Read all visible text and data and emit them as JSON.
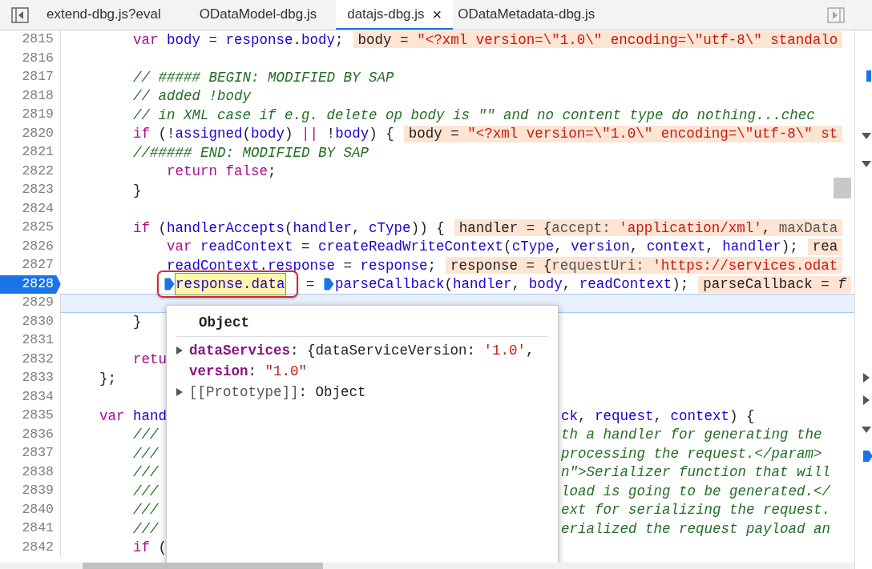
{
  "tabs": [
    {
      "label": "extend-dbg.js?eval",
      "selected": false,
      "closable": false
    },
    {
      "label": "ODataModel-dbg.js",
      "selected": false,
      "closable": false
    },
    {
      "label": "datajs-dbg.js",
      "selected": true,
      "closable": true
    },
    {
      "label": "ODataMetadata-dbg.js",
      "selected": false,
      "closable": false
    }
  ],
  "tab_close": "×",
  "lines": [
    {
      "n": "2815",
      "paused": false,
      "highlighted": false,
      "kind": "two",
      "parts": [
        {
          "kind": "code",
          "tokens": [
            {
              "kind": "keyword",
              "text": "var"
            },
            {
              "kind": "ident",
              "text": " body"
            },
            {
              "kind": "punct",
              "text": " = "
            },
            {
              "kind": "ident",
              "text": "response"
            },
            {
              "kind": "punct",
              "text": "."
            },
            {
              "kind": "ident",
              "text": "body"
            },
            {
              "kind": "punct",
              "text": ";"
            }
          ]
        },
        {
          "kind": "value",
          "tokens": [
            {
              "kind": "punct",
              "text": "body = "
            },
            {
              "kind": "string",
              "text": "\"<?xml version=\\\"1.0\\\" encoding=\\\"utf-8\\\" standalo"
            }
          ]
        }
      ]
    },
    {
      "n": "2816",
      "paused": false,
      "highlighted": false
    },
    {
      "n": "2817",
      "paused": false,
      "highlighted": false,
      "kind": "two",
      "parts": [
        {
          "kind": "code",
          "tokens": [
            {
              "kind": "comment",
              "text": "// ##### BEGIN: MODIFIED BY SAP"
            }
          ]
        }
      ]
    },
    {
      "n": "2818",
      "paused": false,
      "highlighted": false,
      "kind": "two",
      "parts": [
        {
          "kind": "code",
          "tokens": [
            {
              "kind": "comment",
              "text": "// added !body"
            }
          ]
        }
      ]
    },
    {
      "n": "2819",
      "paused": false,
      "highlighted": false,
      "kind": "two",
      "parts": [
        {
          "kind": "code",
          "tokens": [
            {
              "kind": "comment",
              "text": "// in XML case if e.g. delete op body is \"\" and no content type do nothing...chec"
            }
          ]
        }
      ]
    },
    {
      "n": "2820",
      "paused": false,
      "highlighted": false,
      "kind": "two",
      "parts": [
        {
          "kind": "code",
          "tokens": [
            {
              "kind": "keyword",
              "text": "if"
            },
            {
              "kind": "punct",
              "text": " (!"
            },
            {
              "kind": "ident",
              "text": "assigned"
            },
            {
              "kind": "punct",
              "text": "("
            },
            {
              "kind": "ident",
              "text": "body"
            },
            {
              "kind": "punct",
              "text": ") "
            },
            {
              "kind": "keyword",
              "text": "||"
            },
            {
              "kind": "punct",
              "text": " !"
            },
            {
              "kind": "ident",
              "text": "body"
            },
            {
              "kind": "punct",
              "text": ") {"
            }
          ]
        },
        {
          "kind": "value",
          "tokens": [
            {
              "kind": "punct",
              "text": "body = "
            },
            {
              "kind": "string",
              "text": "\"<?xml version=\\\"1.0\\\" encoding=\\\"utf-8\\\" st"
            }
          ]
        }
      ]
    },
    {
      "n": "2821",
      "paused": false,
      "highlighted": false,
      "kind": "two",
      "parts": [
        {
          "kind": "code",
          "tokens": [
            {
              "kind": "comment",
              "text": "//##### END: MODIFIED BY SAP"
            }
          ]
        }
      ]
    },
    {
      "n": "2822",
      "paused": false,
      "highlighted": false,
      "kind": "three",
      "parts": [
        {
          "kind": "code",
          "tokens": [
            {
              "kind": "keyword",
              "text": "return false"
            },
            {
              "kind": "punct",
              "text": ";"
            }
          ]
        }
      ]
    },
    {
      "n": "2823",
      "paused": false,
      "highlighted": false,
      "kind": "two",
      "parts": [
        {
          "kind": "code",
          "tokens": [
            {
              "kind": "punct",
              "text": "}"
            }
          ]
        }
      ]
    },
    {
      "n": "2824",
      "paused": false,
      "highlighted": false
    },
    {
      "n": "2825",
      "paused": false,
      "highlighted": false,
      "kind": "two",
      "parts": [
        {
          "kind": "code",
          "tokens": [
            {
              "kind": "keyword",
              "text": "if"
            },
            {
              "kind": "punct",
              "text": " ("
            },
            {
              "kind": "ident",
              "text": "handlerAccepts"
            },
            {
              "kind": "punct",
              "text": "("
            },
            {
              "kind": "ident",
              "text": "handler"
            },
            {
              "kind": "punct",
              "text": ", "
            },
            {
              "kind": "ident",
              "text": "cType"
            },
            {
              "kind": "punct",
              "text": ")) {"
            }
          ]
        },
        {
          "kind": "value",
          "tokens": [
            {
              "kind": "punct",
              "text": "handler = {"
            },
            {
              "kind": "key",
              "text": "accept: "
            },
            {
              "kind": "string",
              "text": "'application/xml'"
            },
            {
              "kind": "punct",
              "text": ", "
            },
            {
              "kind": "key",
              "text": "maxData"
            }
          ]
        }
      ]
    },
    {
      "n": "2826",
      "paused": false,
      "highlighted": false,
      "kind": "three",
      "parts": [
        {
          "kind": "code",
          "tokens": [
            {
              "kind": "keyword",
              "text": "var"
            },
            {
              "kind": "ident",
              "text": " readContext"
            },
            {
              "kind": "punct",
              "text": " = "
            },
            {
              "kind": "ident",
              "text": "createReadWriteContext"
            },
            {
              "kind": "punct",
              "text": "("
            },
            {
              "kind": "ident",
              "text": "cType"
            },
            {
              "kind": "punct",
              "text": ", "
            },
            {
              "kind": "ident",
              "text": "version"
            },
            {
              "kind": "punct",
              "text": ", "
            },
            {
              "kind": "ident",
              "text": "context"
            },
            {
              "kind": "punct",
              "text": ", "
            },
            {
              "kind": "ident",
              "text": "handler"
            },
            {
              "kind": "punct",
              "text": ");"
            }
          ]
        },
        {
          "kind": "value",
          "tokens": [
            {
              "kind": "punct",
              "text": "rea"
            }
          ]
        }
      ]
    },
    {
      "n": "2827",
      "paused": false,
      "highlighted": false,
      "kind": "three",
      "parts": [
        {
          "kind": "code",
          "tokens": [
            {
              "kind": "ident",
              "text": "readContext"
            },
            {
              "kind": "punct",
              "text": "."
            },
            {
              "kind": "ident",
              "text": "response"
            },
            {
              "kind": "punct",
              "text": " = "
            },
            {
              "kind": "ident",
              "text": "response"
            },
            {
              "kind": "punct",
              "text": ";"
            }
          ]
        },
        {
          "kind": "value",
          "tokens": [
            {
              "kind": "punct",
              "text": "response = {"
            },
            {
              "kind": "key",
              "text": "requestUri: "
            },
            {
              "kind": "string",
              "text": "'https://services.odat"
            }
          ]
        }
      ]
    },
    {
      "n": "2828",
      "paused": true,
      "highlighted": false,
      "kind": "three",
      "parts": [
        {
          "kind": "inspected",
          "tokens": [
            {
              "kind": "ident",
              "text": "response.data"
            }
          ]
        },
        {
          "kind": "code",
          "tokens": [
            {
              "kind": "punct",
              "text": " = "
            }
          ]
        },
        {
          "kind": "breakpoint"
        },
        {
          "kind": "code",
          "tokens": [
            {
              "kind": "ident",
              "text": "parseCallback"
            },
            {
              "kind": "punct",
              "text": "("
            },
            {
              "kind": "ident",
              "text": "handler"
            },
            {
              "kind": "punct",
              "text": ", "
            },
            {
              "kind": "ident",
              "text": "body"
            },
            {
              "kind": "punct",
              "text": ", "
            },
            {
              "kind": "ident",
              "text": "readContext"
            },
            {
              "kind": "punct",
              "text": ");"
            }
          ]
        },
        {
          "kind": "value",
          "tokens": [
            {
              "kind": "punct",
              "text": "parseCallback = "
            },
            {
              "kind": "italic",
              "text": "f"
            }
          ]
        }
      ]
    },
    {
      "n": "2829",
      "paused": false,
      "highlighted": true
    },
    {
      "n": "2830",
      "paused": false,
      "highlighted": false,
      "kind": "two",
      "parts": [
        {
          "kind": "code",
          "tokens": [
            {
              "kind": "punct",
              "text": "}"
            }
          ]
        }
      ]
    },
    {
      "n": "2831",
      "paused": false,
      "highlighted": false
    },
    {
      "n": "2832",
      "paused": false,
      "highlighted": false,
      "kind": "two",
      "parts": [
        {
          "kind": "code",
          "tokens": [
            {
              "kind": "keyword",
              "text": "retu"
            }
          ]
        }
      ]
    },
    {
      "n": "2833",
      "paused": false,
      "highlighted": false,
      "kind": "one",
      "parts": [
        {
          "kind": "code",
          "tokens": [
            {
              "kind": "punct",
              "text": "};"
            }
          ]
        }
      ]
    },
    {
      "n": "2834",
      "paused": false,
      "highlighted": false
    },
    {
      "n": "2835",
      "paused": false,
      "highlighted": false,
      "kind": "one",
      "parts": [
        {
          "kind": "code",
          "tokens": [
            {
              "kind": "keyword",
              "text": "var"
            },
            {
              "kind": "ident",
              "text": " hand"
            }
          ]
        },
        {
          "kind": "right",
          "tokens": [
            {
              "kind": "ident",
              "text": "ck"
            },
            {
              "kind": "punct",
              "text": ", "
            },
            {
              "kind": "ident",
              "text": "request"
            },
            {
              "kind": "punct",
              "text": ", "
            },
            {
              "kind": "ident",
              "text": "context"
            },
            {
              "kind": "punct",
              "text": ") {"
            }
          ]
        }
      ]
    },
    {
      "n": "2836",
      "paused": false,
      "highlighted": false,
      "kind": "two",
      "parts": [
        {
          "kind": "code",
          "tokens": [
            {
              "kind": "comment",
              "text": "///"
            }
          ]
        },
        {
          "kind": "right",
          "tokens": [
            {
              "kind": "comment",
              "text": "th a handler for generating the"
            }
          ]
        }
      ]
    },
    {
      "n": "2837",
      "paused": false,
      "highlighted": false,
      "kind": "two",
      "parts": [
        {
          "kind": "code",
          "tokens": [
            {
              "kind": "comment",
              "text": "///"
            }
          ]
        },
        {
          "kind": "right",
          "tokens": [
            {
              "kind": "comment",
              "text": "processing the request.</param>"
            }
          ]
        }
      ]
    },
    {
      "n": "2838",
      "paused": false,
      "highlighted": false,
      "kind": "two",
      "parts": [
        {
          "kind": "code",
          "tokens": [
            {
              "kind": "comment",
              "text": "///"
            }
          ]
        },
        {
          "kind": "right",
          "tokens": [
            {
              "kind": "comment",
              "text": "n\">Serializer function that will"
            }
          ]
        }
      ]
    },
    {
      "n": "2839",
      "paused": false,
      "highlighted": false,
      "kind": "two",
      "parts": [
        {
          "kind": "code",
          "tokens": [
            {
              "kind": "comment",
              "text": "///"
            }
          ]
        },
        {
          "kind": "right",
          "tokens": [
            {
              "kind": "comment",
              "text": "load is going to be generated.</"
            }
          ]
        }
      ]
    },
    {
      "n": "2840",
      "paused": false,
      "highlighted": false,
      "kind": "two",
      "parts": [
        {
          "kind": "code",
          "tokens": [
            {
              "kind": "comment",
              "text": "///"
            }
          ]
        },
        {
          "kind": "right",
          "tokens": [
            {
              "kind": "comment",
              "text": "ext for serializing the request."
            }
          ]
        }
      ]
    },
    {
      "n": "2841",
      "paused": false,
      "highlighted": false,
      "kind": "two",
      "parts": [
        {
          "kind": "code",
          "tokens": [
            {
              "kind": "comment",
              "text": "///"
            }
          ]
        },
        {
          "kind": "right",
          "tokens": [
            {
              "kind": "comment",
              "text": "erialized the request payload an"
            }
          ]
        }
      ]
    },
    {
      "n": "2842",
      "paused": false,
      "highlighted": false,
      "kind": "two",
      "parts": [
        {
          "kind": "code",
          "tokens": [
            {
              "kind": "keyword",
              "text": "if"
            },
            {
              "kind": "punct",
              "text": " ("
            }
          ]
        }
      ]
    }
  ],
  "popover": {
    "title": "Object",
    "rows": [
      {
        "expandable": true,
        "tokens": [
          {
            "kind": "prop",
            "text": "dataServices"
          },
          {
            "kind": "punct",
            "text": ": {dataServiceVersion: "
          },
          {
            "kind": "string",
            "text": "'1.0'"
          },
          {
            "kind": "punct",
            "text": ","
          }
        ]
      },
      {
        "expandable": false,
        "tokens": [
          {
            "kind": "prop",
            "text": "version"
          },
          {
            "kind": "punct",
            "text": ": "
          },
          {
            "kind": "string",
            "text": "\"1.0\""
          }
        ]
      },
      {
        "expandable": true,
        "tokens": [
          {
            "kind": "proto",
            "text": "[[Prototype]]"
          },
          {
            "kind": "punct",
            "text": ": Object"
          }
        ]
      }
    ]
  }
}
